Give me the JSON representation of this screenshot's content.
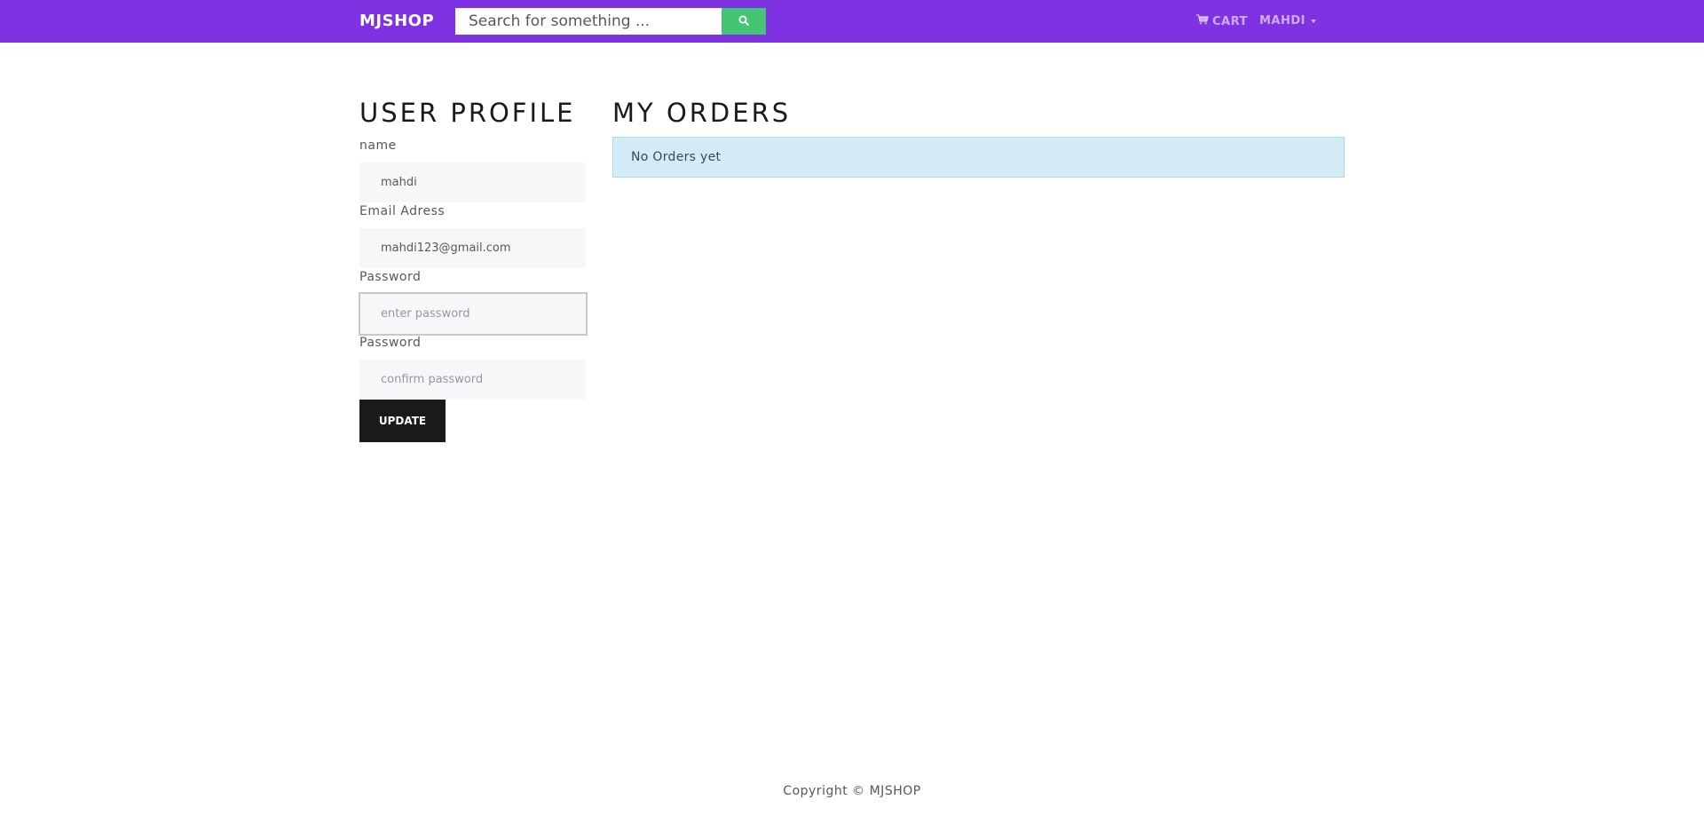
{
  "navbar": {
    "brand": "MJSHOP",
    "search_placeholder": "Search for something ...",
    "search_icon": "search-icon",
    "cart_icon": "shopping-cart-icon",
    "cart_label": "CART",
    "user_label": "MAHDI",
    "background_color": "#7f32e1",
    "search_button_color": "#44c574"
  },
  "profile": {
    "title": "USER PROFILE",
    "name_label": "name",
    "name_value": "mahdi",
    "email_label": "Email Adress",
    "email_value": "mahdi123@gmail.com",
    "password_label": "Password",
    "password_placeholder": "enter password",
    "confirm_label": "Password",
    "confirm_placeholder": "confirm password",
    "update_label": "UPDATE"
  },
  "orders": {
    "title": "MY ORDERS",
    "empty_message": "No Orders yet"
  },
  "footer": {
    "copyright": "Copyright © MJSHOP"
  }
}
